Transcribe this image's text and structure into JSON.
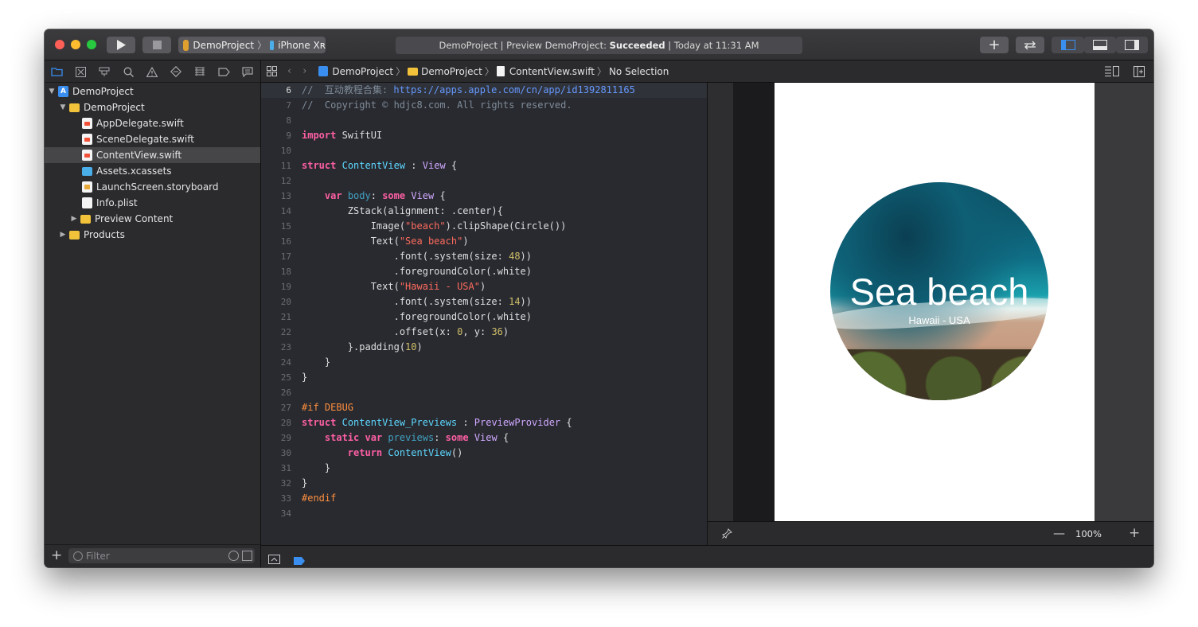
{
  "titlebar": {
    "scheme_project": "DemoProject",
    "scheme_device": "iPhone Xʀ",
    "status_prefix": "DemoProject | Preview DemoProject: ",
    "status_result": "Succeeded",
    "status_suffix": " | Today at 11:31 AM"
  },
  "navigator": {
    "items": [
      {
        "label": "DemoProject",
        "kind": "project"
      },
      {
        "label": "DemoProject",
        "kind": "folder"
      },
      {
        "label": "AppDelegate.swift",
        "kind": "swift"
      },
      {
        "label": "SceneDelegate.swift",
        "kind": "swift"
      },
      {
        "label": "ContentView.swift",
        "kind": "swift"
      },
      {
        "label": "Assets.xcassets",
        "kind": "assets"
      },
      {
        "label": "LaunchScreen.storyboard",
        "kind": "storyboard"
      },
      {
        "label": "Info.plist",
        "kind": "plist"
      },
      {
        "label": "Preview Content",
        "kind": "folder"
      },
      {
        "label": "Products",
        "kind": "folder"
      }
    ],
    "filter_placeholder": "Filter"
  },
  "jumpbar": {
    "crumbs": [
      "DemoProject",
      "DemoProject",
      "ContentView.swift",
      "No Selection"
    ]
  },
  "editor": {
    "lines": [
      {
        "n": "6",
        "t": "//  互动教程合集: https://apps.apple.com/cn/app/id1392811165"
      },
      {
        "n": "7",
        "t": "//  Copyright © hdjc8.com. All rights reserved."
      },
      {
        "n": "8",
        "t": ""
      },
      {
        "n": "9",
        "t": "import SwiftUI"
      },
      {
        "n": "10",
        "t": ""
      },
      {
        "n": "11",
        "t": "struct ContentView : View {"
      },
      {
        "n": "12",
        "t": ""
      },
      {
        "n": "13",
        "t": "    var body: some View {"
      },
      {
        "n": "14",
        "t": "        ZStack(alignment: .center){"
      },
      {
        "n": "15",
        "t": "            Image(\"beach\").clipShape(Circle())"
      },
      {
        "n": "16",
        "t": "            Text(\"Sea beach\")"
      },
      {
        "n": "17",
        "t": "                .font(.system(size: 48))"
      },
      {
        "n": "18",
        "t": "                .foregroundColor(.white)"
      },
      {
        "n": "19",
        "t": "            Text(\"Hawaii - USA\")"
      },
      {
        "n": "20",
        "t": "                .font(.system(size: 14))"
      },
      {
        "n": "21",
        "t": "                .foregroundColor(.white)"
      },
      {
        "n": "22",
        "t": "                .offset(x: 0, y: 36)"
      },
      {
        "n": "23",
        "t": "        }.padding(10)"
      },
      {
        "n": "24",
        "t": "    }"
      },
      {
        "n": "25",
        "t": "}"
      },
      {
        "n": "26",
        "t": ""
      },
      {
        "n": "27",
        "t": "#if DEBUG"
      },
      {
        "n": "28",
        "t": "struct ContentView_Previews : PreviewProvider {"
      },
      {
        "n": "29",
        "t": "    static var previews: some View {"
      },
      {
        "n": "30",
        "t": "        return ContentView()"
      },
      {
        "n": "31",
        "t": "    }"
      },
      {
        "n": "32",
        "t": "}"
      },
      {
        "n": "33",
        "t": "#endif"
      },
      {
        "n": "34",
        "t": ""
      }
    ]
  },
  "preview": {
    "title": "Sea beach",
    "subtitle": "Hawaii - USA",
    "zoom": "100%"
  },
  "colors": {
    "keyword": "#fc5fa3",
    "type": "#5dd8ff",
    "string": "#fc6a5d",
    "number": "#d0bf69",
    "comment": "#7f8c98",
    "url": "#6699ff",
    "preprocessor": "#fd8f3f",
    "accent": "#3a8ef0"
  }
}
